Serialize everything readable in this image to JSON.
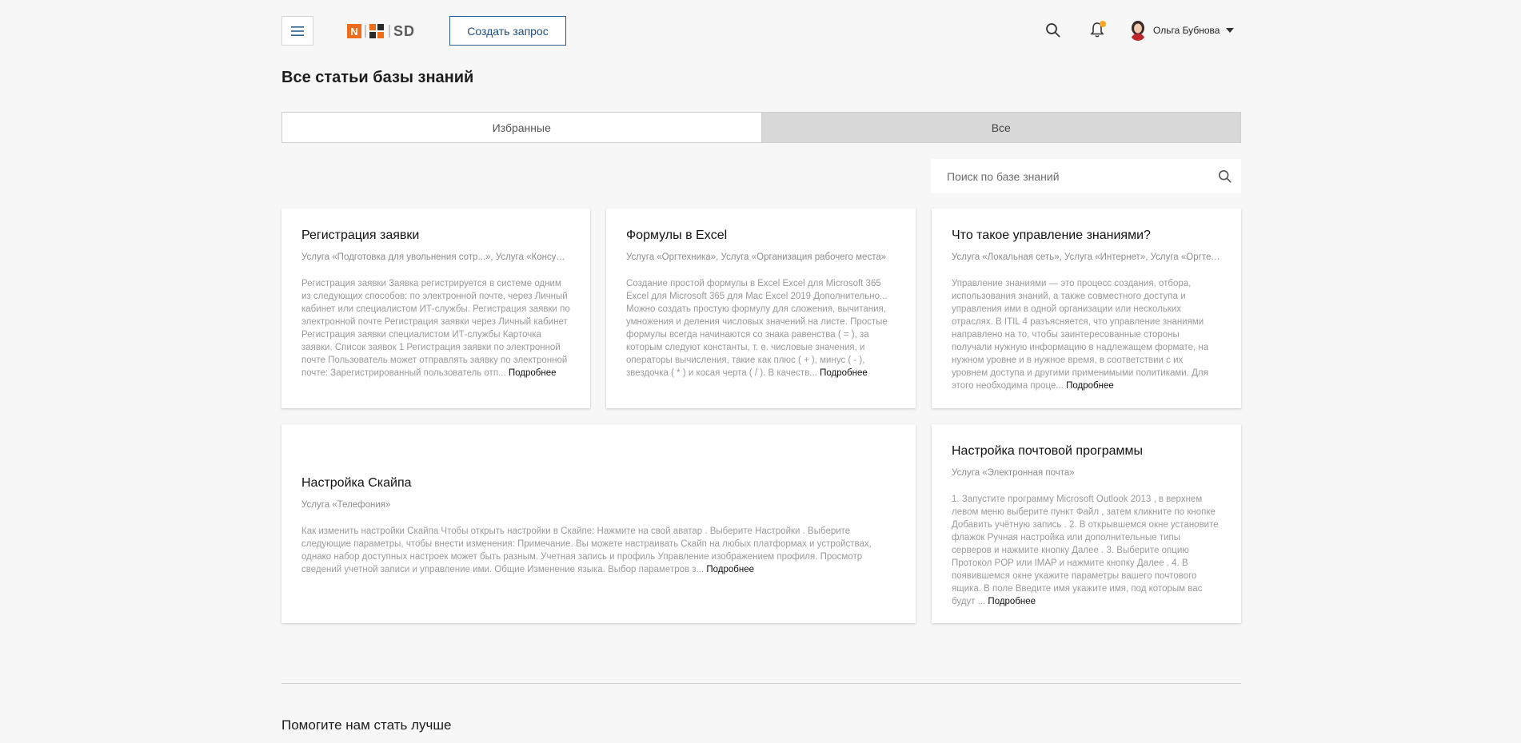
{
  "header": {
    "logo_text": "SD",
    "logo_n": "N",
    "create_request_label": "Создать запрос",
    "user_name": "Ольга Бубнова",
    "colors": {
      "brand_orange": "#ef6c1a",
      "primary_blue": "#1e4f82",
      "notification_dot": "#f5a623"
    }
  },
  "page": {
    "title": "Все статьи базы знаний"
  },
  "tabs": [
    {
      "label": "Избранные",
      "active": false
    },
    {
      "label": "Все",
      "active": true
    }
  ],
  "search": {
    "placeholder": "Поиск по базе знаний"
  },
  "articles": [
    {
      "title": "Регистрация заявки",
      "services": "Услуга «Подготовка для увольнения сотр...», Услуга «Консультация»",
      "excerpt": "Регистрация заявки Заявка регистрируется в системе одним из следующих способов: по электронной почте, через Личный кабинет или специалистом ИТ-службы. Регистрация заявки по электронной почте Регистрация заявки через Личный кабинет Регистрация заявки специалистом ИТ-службы Карточка заявки. Список заявок 1 Регистрация заявки по электронной почте Пользователь может отправлять заявку по электронной почте: Зарегистрированный пользователь отп...",
      "more": "Подробнее"
    },
    {
      "title": "Формулы в Excel",
      "services": "Услуга «Оргтехника», Услуга «Организация рабочего места»",
      "excerpt": "Создание простой формулы в Excel Excel для Microsoft 365 Excel для Microsoft 365 для Mac Excel 2019 Дополнительно... Можно создать простую формулу для сложения, вычитания, умножения и деления числовых значений на листе. Простые формулы всегда начинаются со знака равенства ( = ), за которым следуют константы, т. е. числовые значения, и операторы вычисления, такие как плюс ( + ), минус ( - ), звездочка ( * ) и косая черта ( / ). В качеств...",
      "more": "Подробнее"
    },
    {
      "title": "Что такое управление знаниями?",
      "services": "Услуга «Локальная сеть», Услуга «Интернет», Услуга «Оргтехника»",
      "excerpt": "Управление знаниями — это процесс создания, отбора, использования знаний, а также совместного доступа и управления ими в одной организации или нескольких отраслях. В ITIL 4 разъясняется, что управление знаниями направлено на то, чтобы заинтересованные стороны получали нужную информацию в надлежащем формате, на нужном уровне и в нужное время, в соответствии с их уровнем доступа и другими применимыми политиками. Для этого необходима проце...",
      "more": "Подробнее"
    },
    {
      "title": "Настройка Скайпа",
      "services": "Услуга «Телефония»",
      "excerpt": "Как изменить настройки Скайпа Чтобы открыть настройки в Скайпе: Нажмите на свой аватар . Выберите Настройки . Выберите следующие параметры, чтобы внести изменения: Примечание. Вы можете настраивать Скайп на любых платформах и устройствах, однако набор доступных настроек может быть разным. Учетная запись и профиль Управление изображением профиля. Просмотр сведений учетной записи и управление ими. Общие Изменение языка. Выбор параметров з...",
      "more": "Подробнее"
    },
    {
      "title": "Настройка почтовой программы",
      "services": "Услуга «Электронная почта»",
      "excerpt": "1. Запустите программу Microsoft Outlook 2013 , в верхнем левом меню выберите пункт Файл , затем кликните по кнопке Добавить учётную запись . 2. В открывшемся окне установите флажок Ручная настройка или дополнительные типы серверов и нажмите кнопку Далее . 3. Выберите опцию Протокол POP или IMAP и нажмите кнопку Далее . 4. В появившемся окне укажите параметры вашего почтового ящика. В поле Введите имя укажите имя, под которым вас будут ...",
      "more": "Подробнее"
    }
  ],
  "footer": {
    "help_title": "Помогите нам стать лучше"
  }
}
